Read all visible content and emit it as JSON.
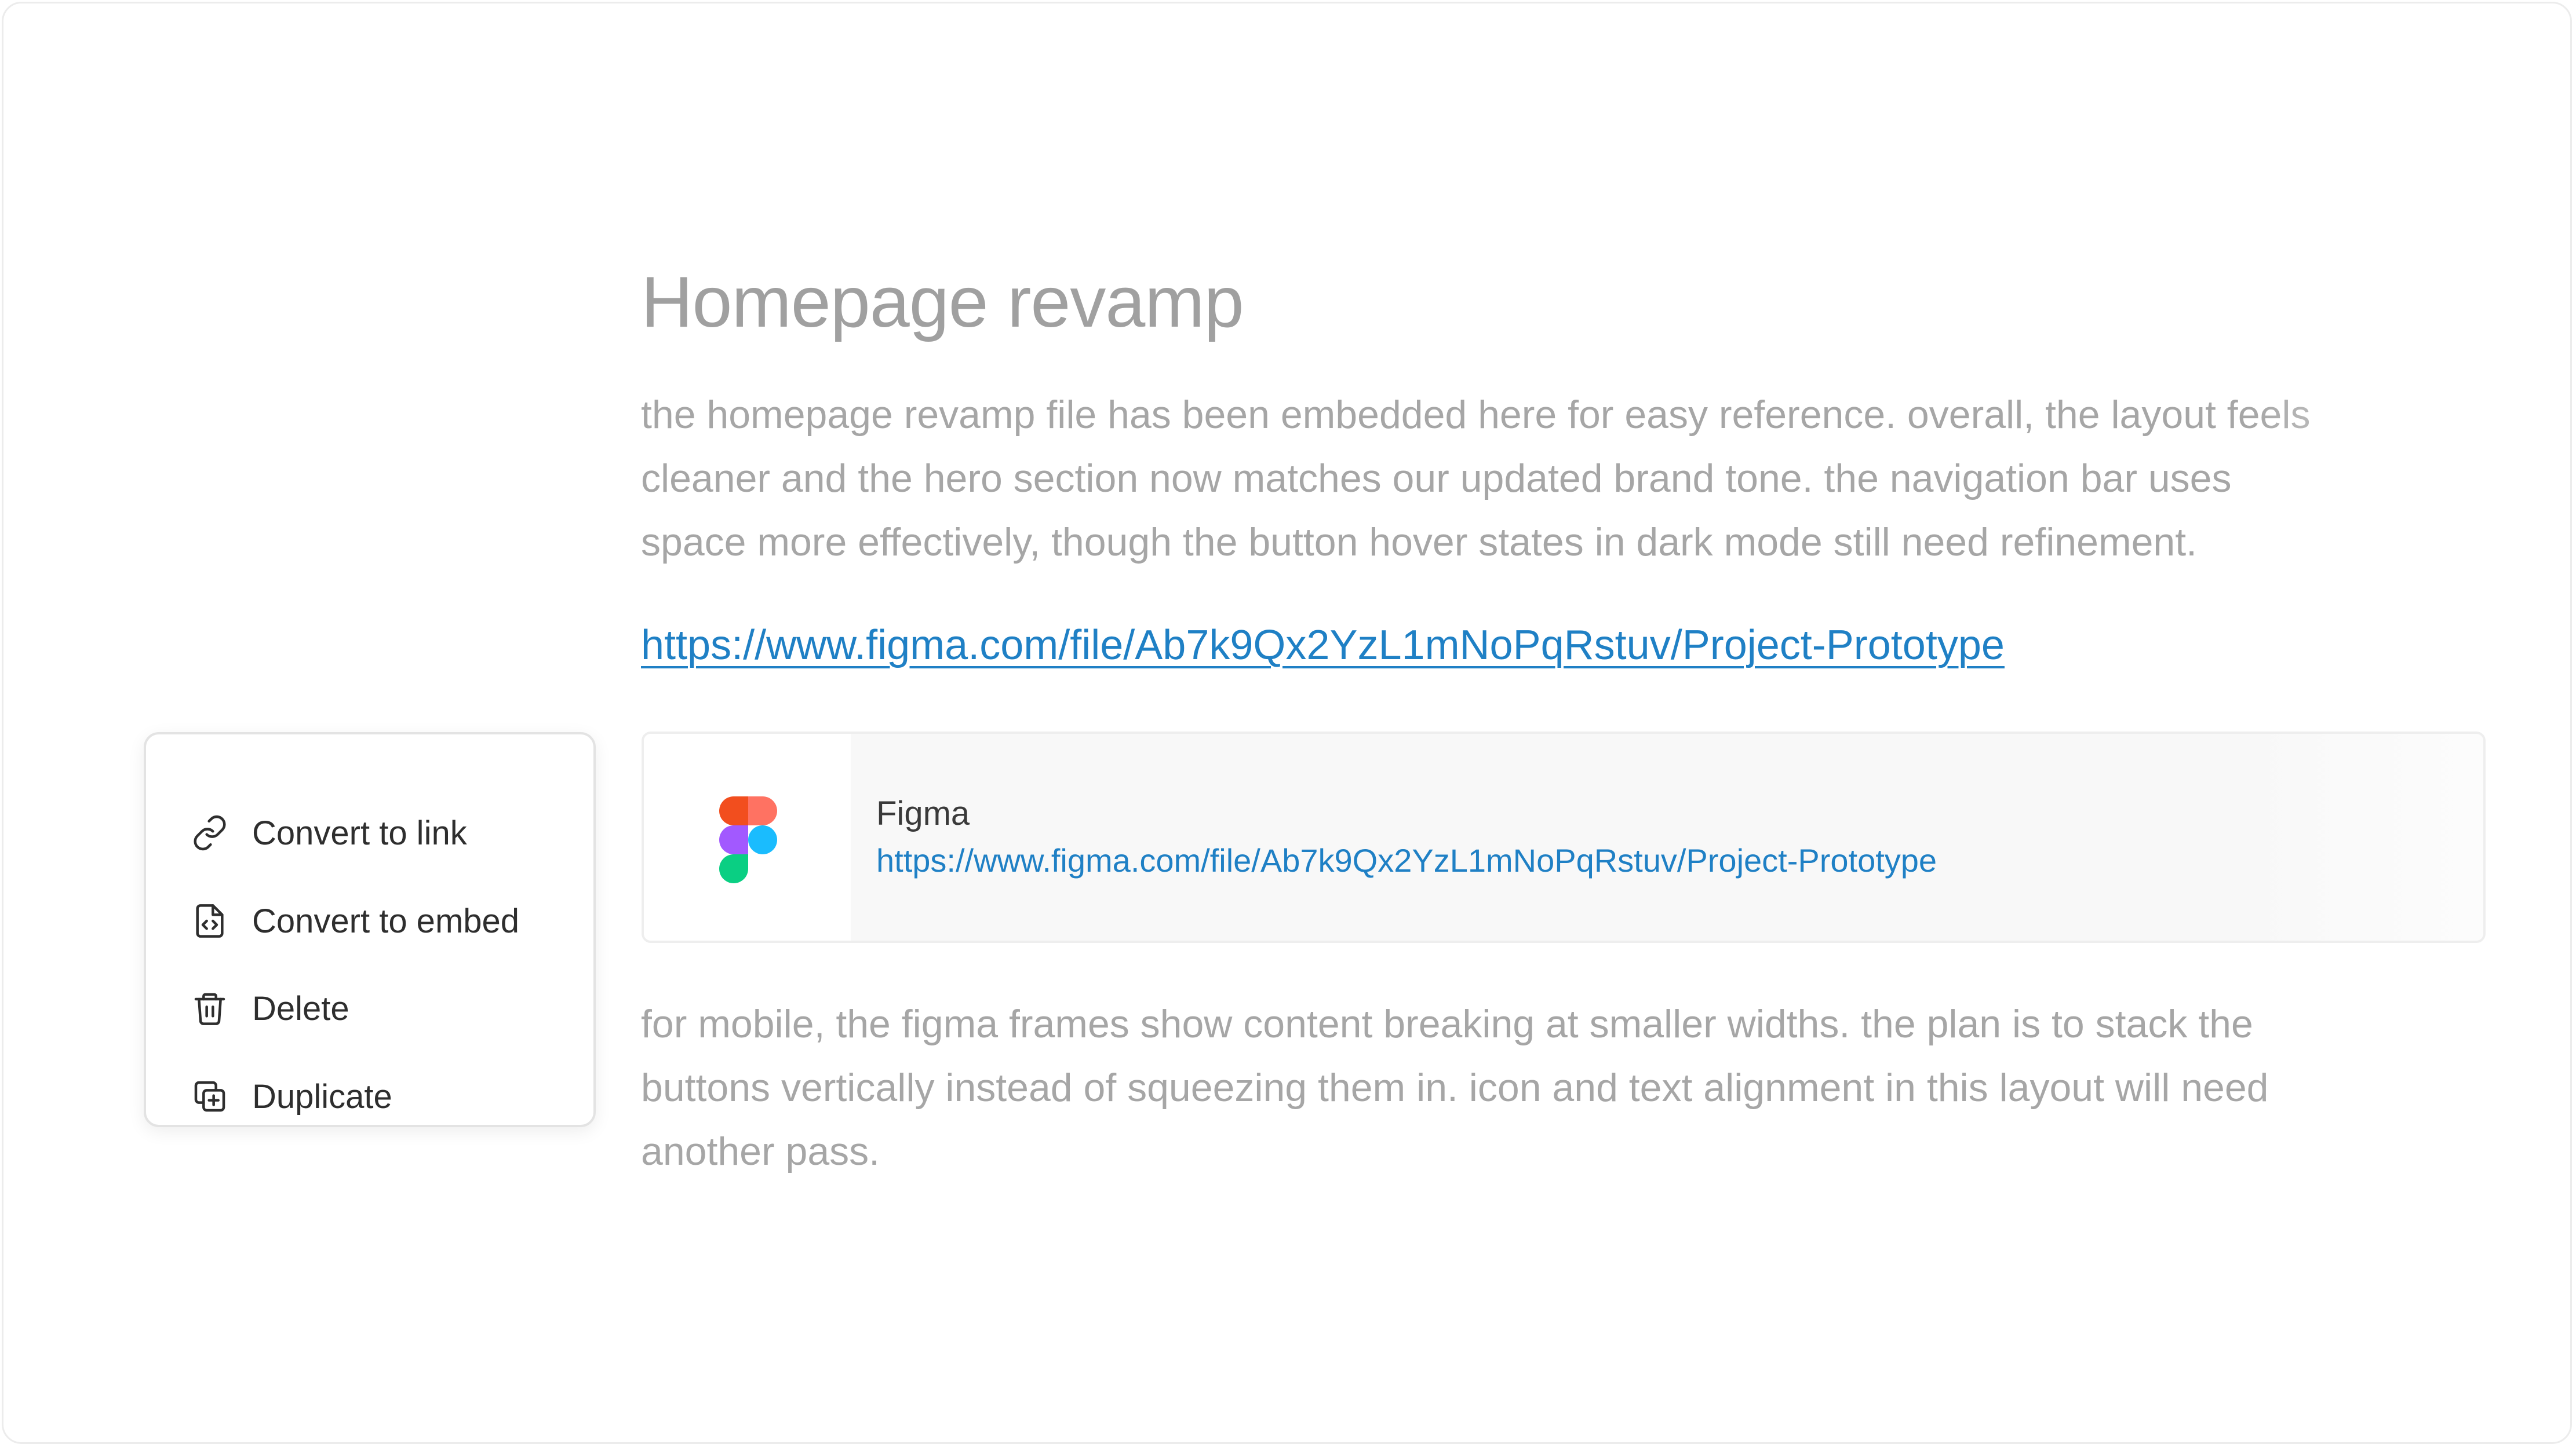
{
  "document": {
    "title": "Homepage revamp",
    "paragraph1_lines": [
      "the homepage revamp file has been embedded here for easy reference. overall, the layout feels",
      "cleaner and the hero section now matches our updated brand tone. the navigation bar uses",
      "space more effectively, though the button hover states in dark mode still need refinement."
    ],
    "link_url": "https://www.figma.com/file/Ab7k9Qx2YzL1mNoPqRstuv/Project-Prototype",
    "embed": {
      "name": "Figma",
      "url": "https://www.figma.com/file/Ab7k9Qx2YzL1mNoPqRstuv/Project-Prototype",
      "icon": "figma-logo"
    },
    "paragraph2_lines": [
      "for mobile, the figma frames show content breaking at smaller widths. the plan is to stack the",
      "buttons vertically instead of squeezing them in. icon and text alignment in this layout will need",
      "another pass."
    ]
  },
  "context_menu": {
    "items": [
      {
        "label": "Convert to link",
        "icon": "link-icon"
      },
      {
        "label": "Convert to embed",
        "icon": "embed-file-icon"
      },
      {
        "label": "Delete",
        "icon": "trash-icon"
      },
      {
        "label": "Duplicate",
        "icon": "duplicate-icon"
      }
    ]
  },
  "colors": {
    "link": "#1f80c5",
    "muted_text": "#a6a6a6",
    "menu_text": "#2e2e2e"
  }
}
